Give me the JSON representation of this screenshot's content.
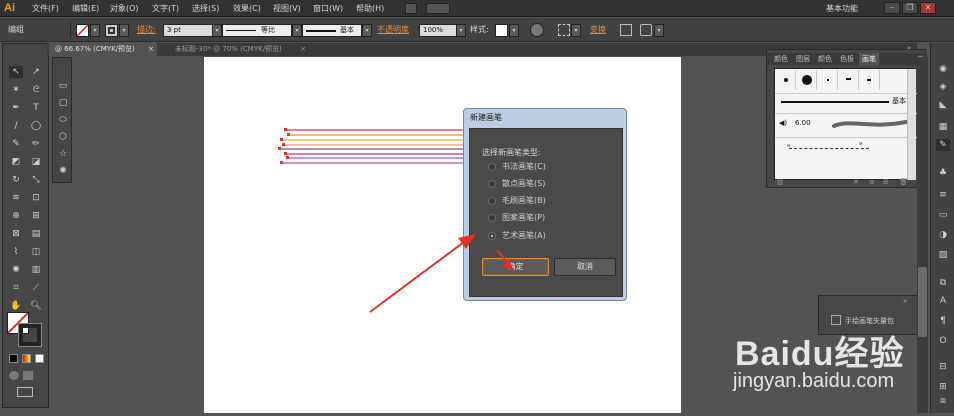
{
  "app": {
    "logo": "Ai"
  },
  "menu": [
    "文件(F)",
    "编辑(E)",
    "对象(O)",
    "文字(T)",
    "选择(S)",
    "效果(C)",
    "视图(V)",
    "窗口(W)",
    "帮助(H)"
  ],
  "workspace": "基本功能",
  "window_controls": [
    "–",
    "❐",
    "✕"
  ],
  "control_bar": {
    "selection_label": "编组",
    "stroke_label": "描边:",
    "stroke_weight": "3 pt",
    "profile_label": "等比",
    "brush_label": "基本",
    "opacity_label": "不透明度",
    "opacity_value": "100%",
    "style_label": "样式:",
    "transform_label": "变换"
  },
  "tabs": [
    {
      "label": "@ 66.67% (CMYK/预览)",
      "close": "×",
      "active": true
    },
    {
      "label": "未标题-30* @ 70% (CMYK/预览)",
      "close": "×",
      "active": false
    }
  ],
  "dialog": {
    "title": "新建画笔",
    "prompt": "选择新画笔类型:",
    "options": [
      {
        "label": "书法画笔(C)",
        "selected": false
      },
      {
        "label": "散点画笔(S)",
        "selected": false
      },
      {
        "label": "毛刷画笔(B)",
        "selected": false
      },
      {
        "label": "图案画笔(P)",
        "selected": false
      },
      {
        "label": "艺术画笔(A)",
        "selected": true
      }
    ],
    "ok_label": "确定",
    "cancel_label": "取消"
  },
  "brush_panel": {
    "tabs": [
      "颜色",
      "图层",
      "颜色",
      "色板",
      "画笔"
    ],
    "active_tab": "画笔",
    "basic_label": "基本",
    "size_value": "6.00"
  },
  "small_panel": {
    "label": "手绘画笔矢量包"
  },
  "watermark": {
    "brand": "Baidu经验",
    "url": "jingyan.baidu.com"
  },
  "colors": {
    "accent": "#e58b3a",
    "arrow": "#e2332a",
    "line_colors": [
      "#cf3b3b",
      "#e39a3a",
      "#d9b34a",
      "#e6a06a",
      "#7a4b8e",
      "#b53d7a",
      "#a85ab8",
      "#d24a8a"
    ]
  }
}
